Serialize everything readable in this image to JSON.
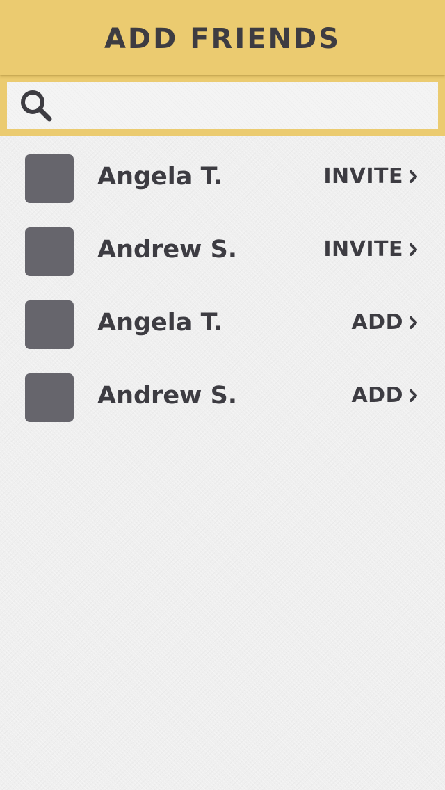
{
  "header": {
    "title": "ADD FRIENDS"
  },
  "search": {
    "icon": "search-icon",
    "placeholder": "",
    "value": ""
  },
  "friends": [
    {
      "name": "Angela T.",
      "action": "INVITE",
      "action_icon": "chevron-right-icon"
    },
    {
      "name": "Andrew S.",
      "action": "INVITE",
      "action_icon": "chevron-right-icon"
    },
    {
      "name": "Angela T.",
      "action": "ADD",
      "action_icon": "chevron-right-icon"
    },
    {
      "name": "Andrew S.",
      "action": "ADD",
      "action_icon": "chevron-right-icon"
    }
  ],
  "colors": {
    "header_bg": "#ebcb70",
    "text": "#3d3c42",
    "avatar": "#66656c",
    "page_bg": "#efefef"
  }
}
